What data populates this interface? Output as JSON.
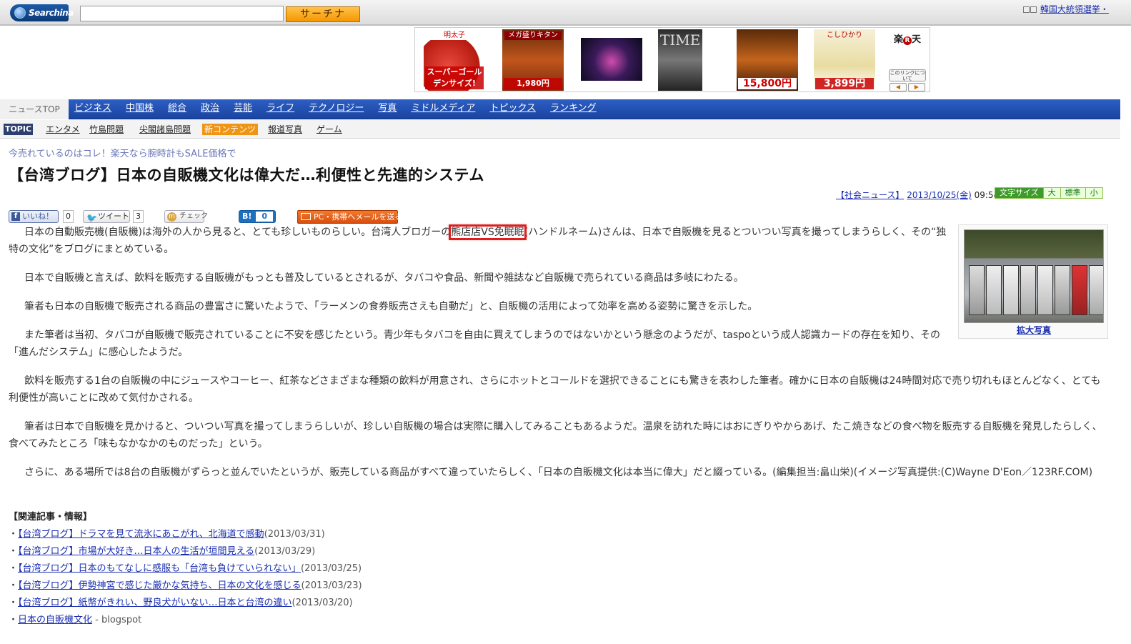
{
  "header": {
    "logo": "Searchina",
    "search_placeholder": "",
    "search_button": "サーチナ",
    "top_right_link": "韓国大統領選挙・"
  },
  "ads": {
    "items": [
      {
        "tag": "明太子",
        "caption": "スーパーゴールデンサイズ!"
      },
      {
        "tag": "メガ盛りキタン",
        "caption": "1,980円"
      },
      {
        "tag": "",
        "caption": ""
      },
      {
        "tag": "TIME",
        "caption": ""
      },
      {
        "tag": "",
        "caption": "15,800円"
      },
      {
        "tag": "こしひかり",
        "caption": "3,899円"
      }
    ],
    "rakuten_logo_pre": "楽",
    "rakuten_logo_r": "R",
    "rakuten_logo_post": "天",
    "rakuten_link": "このリンクについて",
    "prev": "◀",
    "next": "▶"
  },
  "nav": {
    "top": "ニュースTOP",
    "items": [
      "ビジネス",
      "中国株",
      "総合",
      "政治",
      "芸能",
      "ライフ",
      "テクノロジー",
      "写真",
      "ミドルメディア",
      "トピックス",
      "ランキング"
    ]
  },
  "subnav": {
    "topic": "TOPIC",
    "items": [
      "エンタメ",
      "竹島問題",
      "尖閣諸島問題"
    ],
    "new": "新コンテンツ",
    "items2": [
      "報道写真",
      "ゲーム"
    ]
  },
  "article": {
    "promo": "今売れているのはコレ！楽天なら腕時計もSALE価格で",
    "title": "【台湾ブログ】日本の自販機文化は偉大だ…利便性と先進的システム",
    "category": "【社会ニュース】",
    "date": "2013/10/25(金)",
    "time": "09:54",
    "fontsize": {
      "label": "文字サイズ",
      "large": "大",
      "normal": "標準",
      "small": "小"
    },
    "social": {
      "like": "いいね！",
      "like_count": "0",
      "tweet": "ツイート",
      "tweet_count": "3",
      "check": "チェック",
      "hatena": "B!",
      "hatena_count": "0",
      "mail": "PC・携帯へメールを送る"
    },
    "p1_a": "日本の自動販売機(自販機)は海外の人から見ると、とても珍しいものらしい。台湾人ブロガーの",
    "p1_hl": "熊店店VS免眠眠",
    "p1_b": "(ハンドルネーム)さんは、日本で自販機を見るとついつい写真を撮ってしまうらしく、その“独特の文化”をブログにまとめている。",
    "p2": "日本で自販機と言えば、飲料を販売する自販機がもっとも普及しているとされるが、タバコや食品、新聞や雑誌など自販機で売られている商品は多岐にわたる。",
    "p3": "筆者も日本の自販機で販売される商品の豊富さに驚いたようで、「ラーメンの食券販売さえも自動だ」と、自販機の活用によって効率を高める姿勢に驚きを示した。",
    "p4": "また筆者は当初、タバコが自販機で販売されていることに不安を感じたという。青少年もタバコを自由に買えてしまうのではないかという懸念のようだが、taspoという成人認識カードの存在を知り、その「進んだシステム」に感心したようだ。",
    "p5": "飲料を販売する1台の自販機の中にジュースやコーヒー、紅茶などさまざまな種類の飲料が用意され、さらにホットとコールドを選択できることにも驚きを表わした筆者。確かに日本の自販機は24時間対応で売り切れもほとんどなく、とても利便性が高いことに改めて気付かされる。",
    "p6": "筆者は日本で自販機を見かけると、ついつい写真を撮ってしまうらしいが、珍しい自販機の場合は実際に購入してみることもあるようだ。温泉を訪れた時にはおにぎりやからあげ、たこ焼きなどの食べ物を販売する自販機を発見したらしく、食べてみたところ「味もなかなかのものだった」という。",
    "p7": "さらに、ある場所では8台の自販機がずらっと並んでいたというが、販売している商品がすべて違っていたらしく、「日本の自販機文化は本当に偉大」だと綴っている。(編集担当:畠山栄)(イメージ写真提供:(C)Wayne D'Eon／123RF.COM)",
    "photo_link": "拡大写真"
  },
  "related": {
    "heading": "【関連記事・情報】",
    "items": [
      {
        "link": "【台湾ブログ】ドラマを見て流氷にあこがれ、北海道で感動",
        "date": "(2013/03/31)"
      },
      {
        "link": "【台湾ブログ】市場が大好き…日本人の生活が垣間見える",
        "date": "(2013/03/29)"
      },
      {
        "link": "【台湾ブログ】日本のもてなしに感服も「台湾も負けていられない」",
        "date": "(2013/03/25)"
      },
      {
        "link": "【台湾ブログ】伊勢神宮で感じた厳かな気持ち、日本の文化を感じる",
        "date": "(2013/03/23)"
      },
      {
        "link": "【台湾ブログ】紙幣がきれい、野良犬がいない…日本と台湾の違い",
        "date": "(2013/03/20)"
      }
    ],
    "last_link": "日本の自販機文化",
    "last_suffix": " - blogspot"
  },
  "colors": {
    "nav_blue": "#2d5fc4",
    "accent_orange": "#f59600",
    "highlight_red": "#e01c1c"
  }
}
